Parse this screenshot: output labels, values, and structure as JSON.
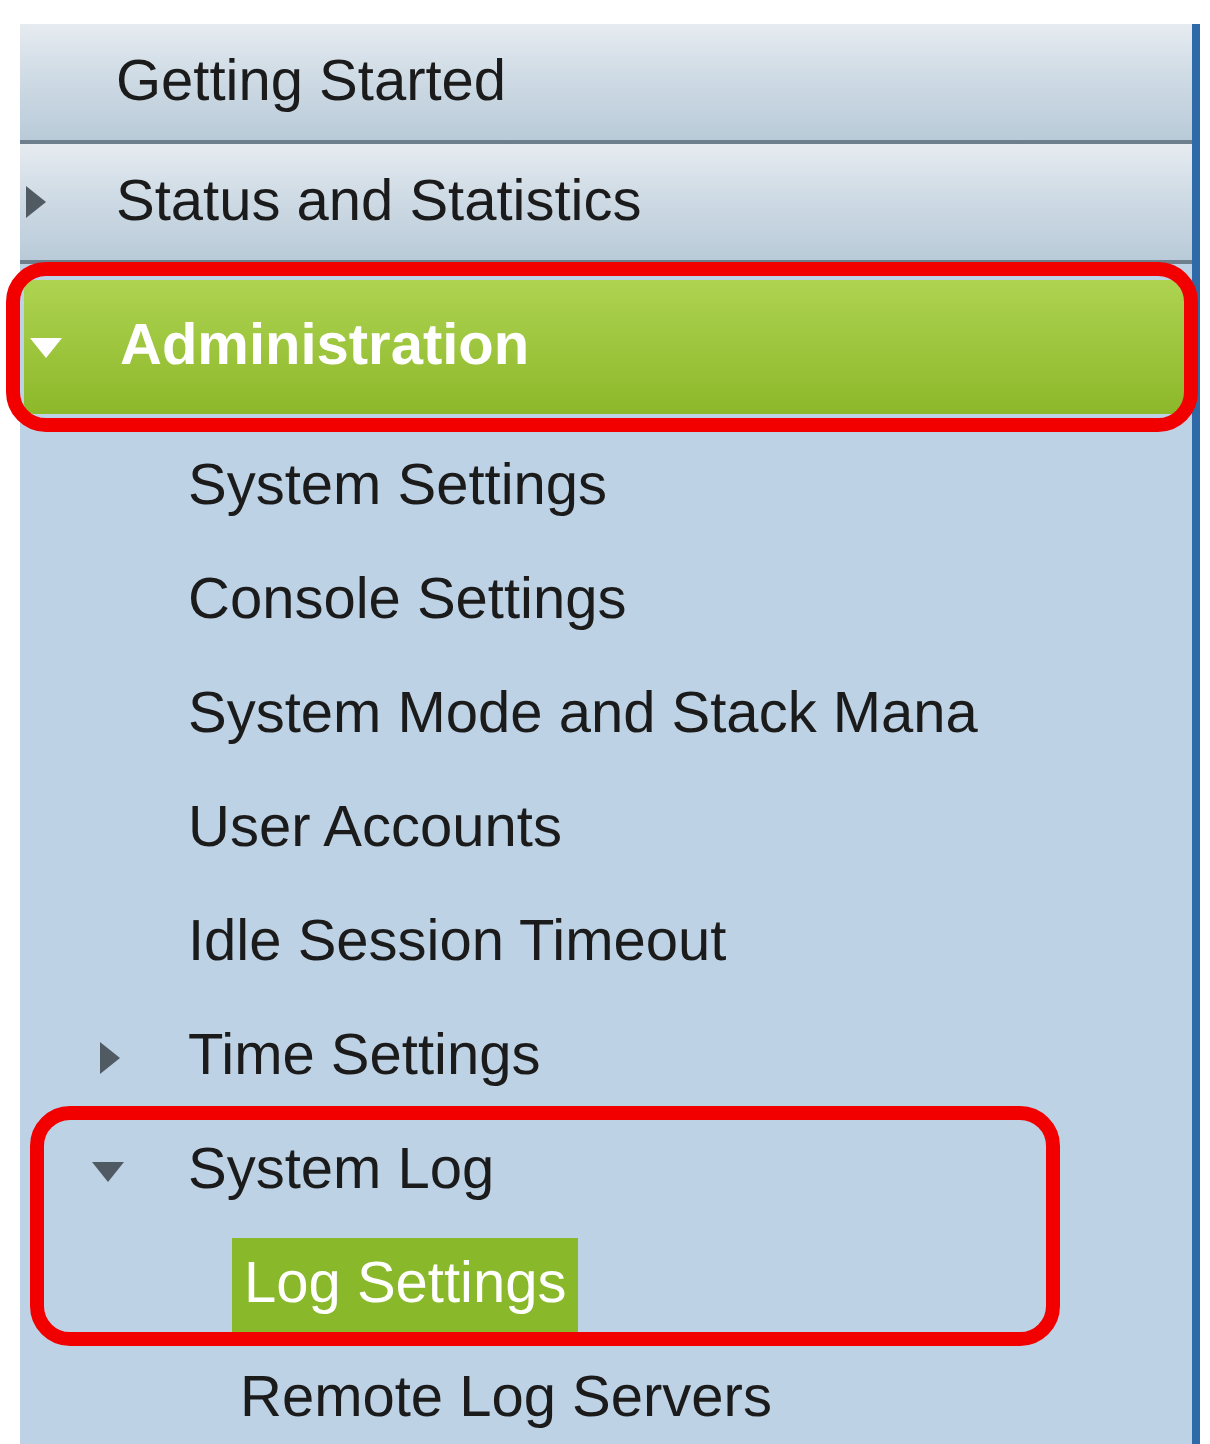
{
  "nav": {
    "items": [
      {
        "label": "Getting Started",
        "selected": false,
        "framed": false
      },
      {
        "label": "Status and Statistics",
        "kind": "folder",
        "expanded": false,
        "selected": false,
        "framed": false
      },
      {
        "label": "Administration",
        "kind": "folder",
        "expanded": true,
        "selected": true,
        "framed": true,
        "children": [
          {
            "label": "System Settings",
            "selected": false,
            "framed": false
          },
          {
            "label": "Console Settings",
            "selected": false,
            "framed": false
          },
          {
            "label": "System Mode and Stack Mana",
            "selected": false,
            "framed": false
          },
          {
            "label": "User Accounts",
            "selected": false,
            "framed": false
          },
          {
            "label": "Idle Session Timeout",
            "selected": false,
            "framed": false
          },
          {
            "label": "Time Settings",
            "kind": "folder",
            "expanded": false,
            "selected": false,
            "framed": false
          },
          {
            "label": "System Log",
            "kind": "folder",
            "expanded": true,
            "selected": false,
            "framed": true,
            "children": [
              {
                "label": "Log Settings",
                "selected": true,
                "framed": true
              },
              {
                "label": "Remote Log Servers",
                "selected": false,
                "framed": false
              }
            ]
          }
        ]
      }
    ]
  }
}
